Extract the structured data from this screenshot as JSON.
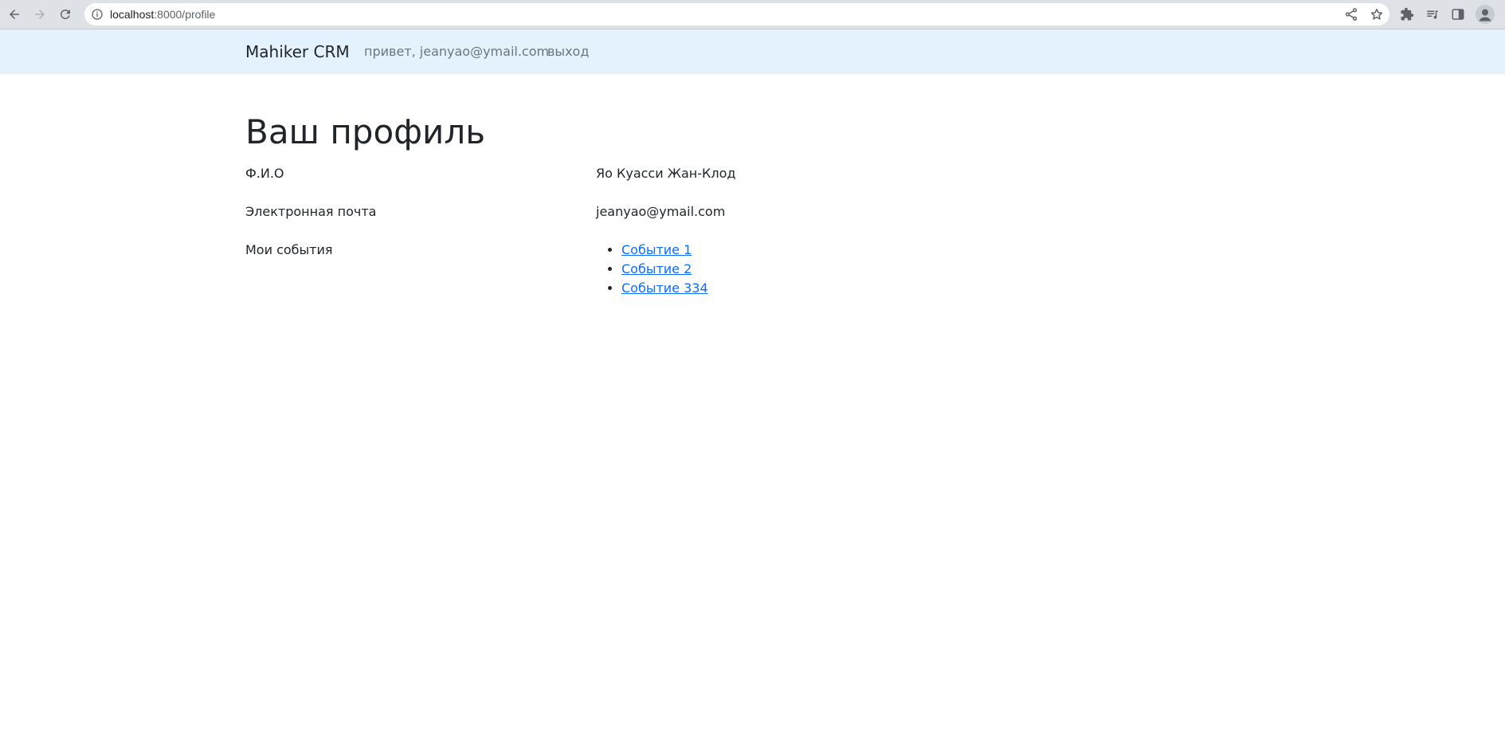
{
  "browser": {
    "url_host": "localhost",
    "url_path": ":8000/profile",
    "icons": {
      "back": "back-arrow-icon",
      "forward": "forward-arrow-icon",
      "reload": "reload-icon",
      "info": "info-icon",
      "share": "share-icon",
      "bookmark": "star-icon",
      "extensions": "puzzle-icon",
      "reading_list": "reading-list-icon",
      "side_panel": "side-panel-icon",
      "profile": "profile-avatar-icon"
    }
  },
  "navbar": {
    "brand": "Mahiker CRM",
    "greeting": "привет, jeanyao@ymail.com",
    "logout": "выход",
    "background": "#e3f2fd"
  },
  "profile": {
    "title": "Ваш профиль",
    "fields": [
      {
        "label": "Ф.И.О",
        "value": "Яо Куасси Жан-Клод"
      },
      {
        "label": "Электронная почта",
        "value": "jeanyao@ymail.com"
      }
    ],
    "events_label": "Мои события",
    "events": [
      "Событие 1",
      "Событие 2",
      "Событие 334"
    ],
    "link_color": "#0d6efd"
  }
}
